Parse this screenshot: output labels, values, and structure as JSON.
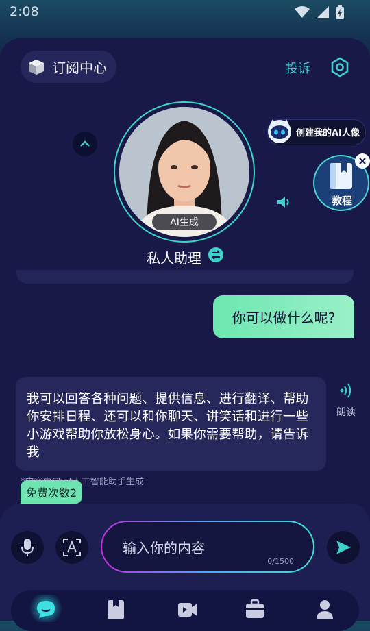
{
  "status_bar": {
    "time": "2:08"
  },
  "header": {
    "subscription_label": "订阅中心",
    "complaint_label": "投诉"
  },
  "assistant": {
    "badge": "AI生成",
    "name": "私人助理"
  },
  "create_avatar": {
    "label": "创建我的AI人像"
  },
  "tutorial": {
    "label": "教程"
  },
  "chat": {
    "user_message": "你可以做什么呢?",
    "bot_message": "我可以回答各种问题、提供信息、进行翻译、帮助你安排日程、还可以和你聊天、讲笑话和进行一些小游戏帮助你放松身心。如果你需要帮助，请告诉我",
    "read_label": "朗读",
    "disclaimer": "*内容由Chat人工智能助手生成",
    "free_count": "免费次数2"
  },
  "input": {
    "placeholder": "输入你的内容",
    "char_count": "0/1500"
  },
  "colors": {
    "accent": "#3dd2c7",
    "bubble_user": "#7fecbc",
    "background": "#181849"
  },
  "nav": {
    "items": [
      "chat-icon",
      "bookmark-icon",
      "video-icon",
      "briefcase-icon",
      "profile-icon"
    ],
    "active": "chat-icon"
  }
}
